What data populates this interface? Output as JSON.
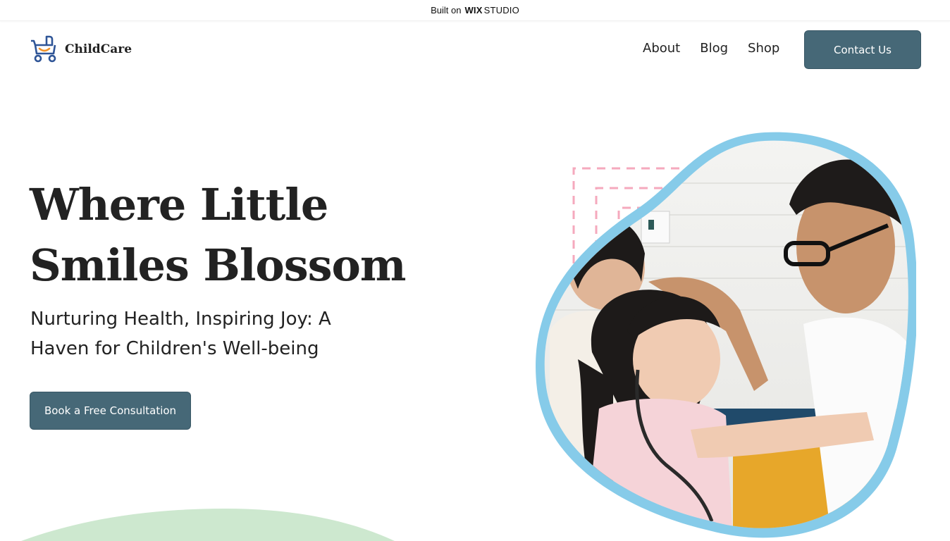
{
  "topbar": {
    "prefix": "Built on",
    "brand_bold": "WIX",
    "brand_light": "STUDIO"
  },
  "logo": {
    "name": "ChildCare"
  },
  "nav": {
    "items": [
      "About",
      "Blog",
      "Shop"
    ],
    "contact_label": "Contact Us"
  },
  "hero": {
    "title_line1": "Where Little",
    "title_line2": "Smiles Blossom",
    "subtitle_line1": "Nurturing Health, Inspiring Joy: A",
    "subtitle_line2": "Haven for Children's Well-being",
    "cta_label": "Book a Free Consultation"
  },
  "colors": {
    "button_bg": "#466877",
    "blob_border": "#86cbe9",
    "dash_pink": "#f5a9bd",
    "green_blob": "#cde8cf",
    "logo_blue": "#2f5597",
    "logo_orange": "#f0932b"
  },
  "icons": {
    "logo": "stroller-icon"
  }
}
